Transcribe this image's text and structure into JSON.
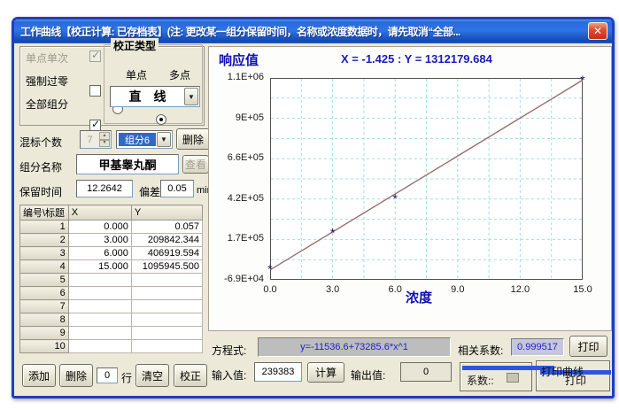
{
  "window": {
    "title": "工作曲线【校正计算: 已存档表】(注: 更改某一组分保留时间，名称或浓度数据时，请先取消“全部...",
    "close_glyph": "✕"
  },
  "left": {
    "checkboxes": [
      {
        "label": "单点单次",
        "checked": true,
        "disabled": true
      },
      {
        "label": "强制过零",
        "checked": false,
        "disabled": false
      },
      {
        "label": "全部组分",
        "checked": true,
        "disabled": false
      }
    ],
    "calib_type": {
      "legend": "校正类型",
      "radio_single": "单点",
      "radio_multi": "多点",
      "curve_select": "直　线"
    },
    "mix": {
      "label": "混标个数",
      "count": "7",
      "component": "组分6",
      "delete": "删除"
    },
    "component": {
      "label": "组分名称",
      "value": "甲基睾丸酮",
      "view": "查看"
    },
    "retention": {
      "label": "保留时间",
      "value": "12.2642",
      "dev_label": "偏差",
      "dev_value": "0.05",
      "unit": "min"
    },
    "table": {
      "headers": [
        "编号\\标题",
        "X",
        "Y"
      ],
      "rows": [
        [
          "1",
          "0.000",
          "0.057"
        ],
        [
          "2",
          "3.000",
          "209842.344"
        ],
        [
          "3",
          "6.000",
          "406919.594"
        ],
        [
          "4",
          "15.000",
          "1095945.500"
        ],
        [
          "5",
          "",
          ""
        ],
        [
          "6",
          "",
          ""
        ],
        [
          "7",
          "",
          ""
        ],
        [
          "8",
          "",
          ""
        ],
        [
          "9",
          "",
          ""
        ],
        [
          "10",
          "",
          ""
        ]
      ]
    },
    "actions": {
      "add": "添加",
      "delete": "删除",
      "rows_value": "0",
      "rows_label": "行",
      "clear": "清空",
      "calibrate": "校正"
    }
  },
  "chart_data": {
    "type": "scatter",
    "ylabel": "响应值",
    "xlabel": "浓度",
    "readout": "X = -1.425 : Y = 1312179.684",
    "x": [
      0,
      3,
      6,
      15
    ],
    "y": [
      0.057,
      209842.344,
      406919.594,
      1095945.5
    ],
    "fit": {
      "equation": "y=-11536.6+73285.6*x^1",
      "intercept": -11536.6,
      "slope": 73285.6,
      "r": 0.999517
    },
    "xlim": [
      0,
      15
    ],
    "ylim": [
      -69000,
      1100000
    ],
    "x_ticks": [
      "0.0",
      "3.0",
      "6.0",
      "9.0",
      "12.0",
      "15.0"
    ],
    "y_ticks": [
      "1.1E+06",
      "9E+05",
      "6.6E+05",
      "4.2E+05",
      "1.7E+05",
      "-6.9E+04"
    ],
    "grid": "dashed, 10x10 divisions",
    "legend": "none"
  },
  "bottom": {
    "equation_label": "方程式:",
    "equation_value": "y=-11536.6+73285.6*x^1",
    "corr_label": "相关系数:",
    "corr_value": "0.999517",
    "print": "打印",
    "input_label": "输入值:",
    "input_value": "239383",
    "calc": "计算",
    "output_label": "输出值:",
    "output_value": "0",
    "glitch_coeff": "系数::",
    "glitch_print_curve": "打印曲线",
    "glitch_print": "打印"
  },
  "colors": {
    "grid": "#9fe0e0",
    "fit_line": "#9b6f6f",
    "marker": "#1a1a6e",
    "plot_border": "#505050",
    "blue_text": "#2222cc",
    "accent_blue": "#0f0fb4",
    "highlight": "#316ac5"
  }
}
